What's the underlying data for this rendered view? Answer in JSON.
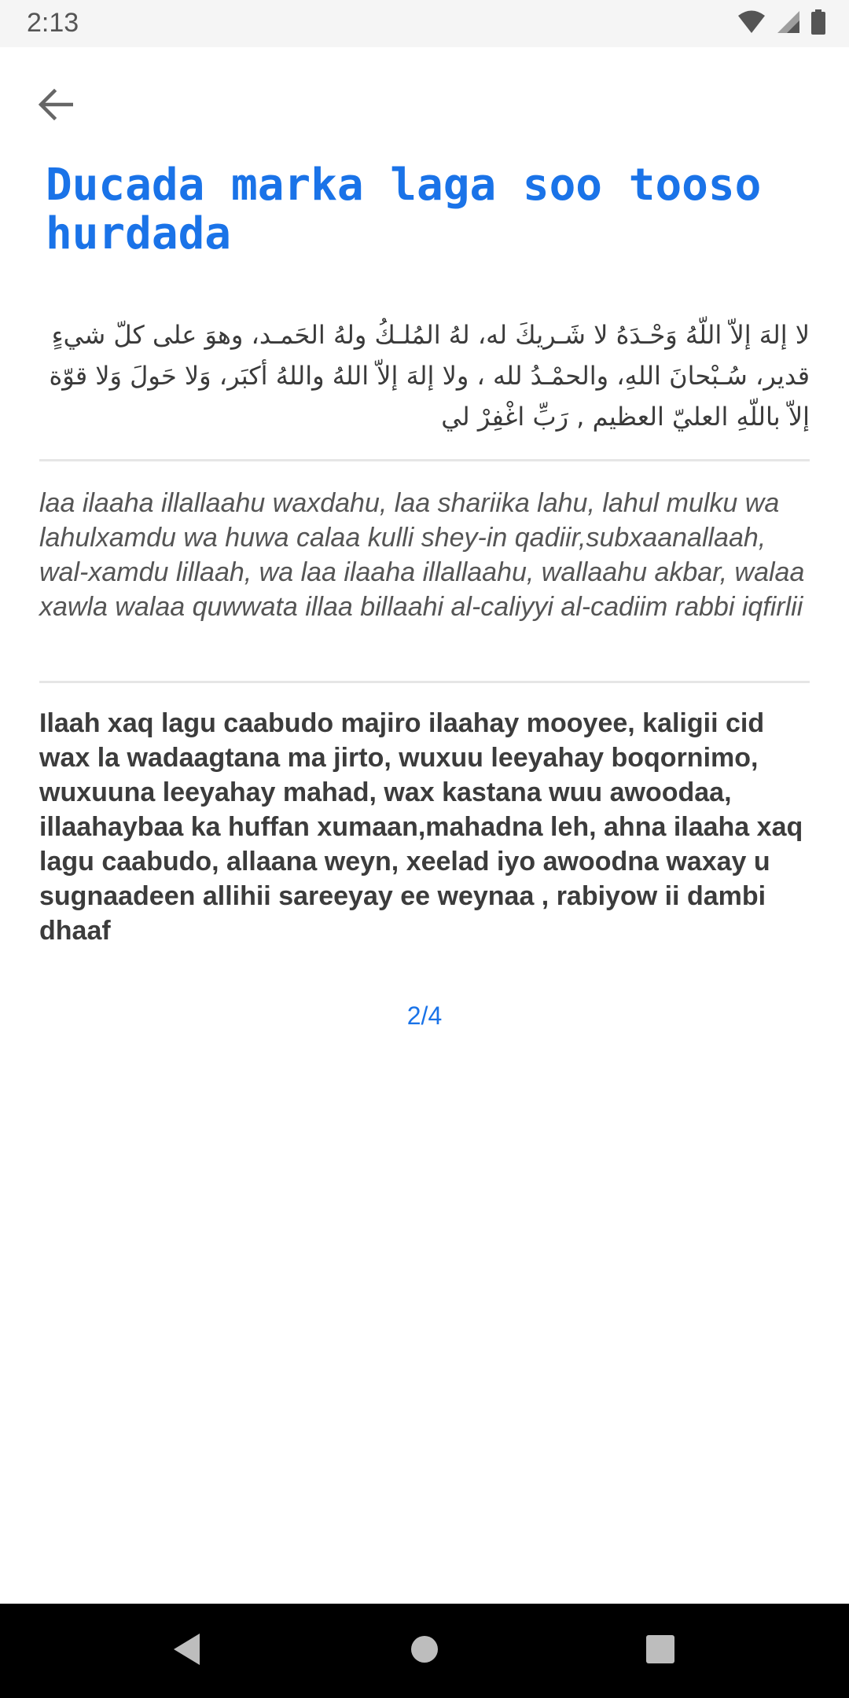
{
  "status_bar": {
    "time": "2:13",
    "icons": [
      "wifi-icon",
      "cell-signal-icon",
      "battery-icon"
    ]
  },
  "app_bar": {
    "back_icon": "arrow-left-icon"
  },
  "content": {
    "title": "Ducada marka laga soo tooso hurdada",
    "arabic": "لا إلهَ إلاّ اللّهُ وَحْـدَهُ لا شَـريكَ له، لهُ المُلـكُ ولهُ الحَمـد، وهوَ على كلّ شيءٍ قدير، سُـبْحانَ اللهِ، والحمْـدُ لله ، ولا إلهَ إلاّ اللهُ واللهُ أكبَر، وَلا حَولَ وَلا قوّة إلاّ باللّهِ العليّ العظيم , رَبِّ اغْفِرْ لي",
    "transliteration": "laa ilaaha illallaahu waxdahu, laa shariika lahu, lahul mulku wa lahulxamdu wa huwa calaa kulli shey-in qadiir,subxaanallaah, wal-xamdu lillaah, wa laa ilaaha illallaahu, wallaahu akbar, walaa xawla walaa quwwata illaa billaahi al-caliyyi al-cadiim rabbi iqfirlii",
    "translation": "Ilaah xaq lagu caabudo majiro ilaahay mooyee, kaligii cid wax la wadaagtana ma jirto, wuxuu leeyahay boqornimo, wuxuuna leeyahay mahad, wax kastana wuu awoodaa, illaahaybaa ka huffan xumaan,mahadna leh, ahna ilaaha xaq lagu caabudo, allaana weyn, xeelad iyo awoodna waxay u sugnaadeen allihii sareeyay ee weynaa , rabiyow ii dambi dhaaf",
    "page_indicator": "2/4"
  },
  "colors": {
    "accent": "#1a73e8",
    "status_bar_bg": "#f5f5f5",
    "nav_bar_bg": "#000000",
    "divider": "#e6e6e6"
  },
  "nav_bar": {
    "icons": [
      "back-triangle-icon",
      "home-circle-icon",
      "recents-square-icon"
    ]
  }
}
